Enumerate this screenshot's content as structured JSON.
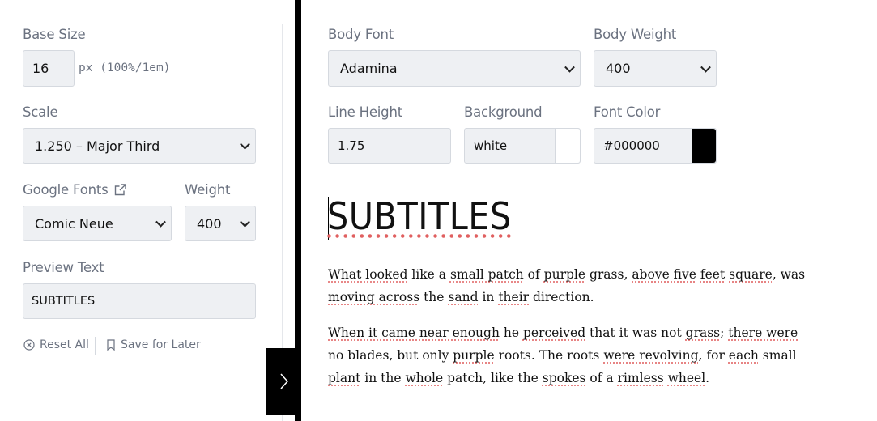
{
  "left_panel": {
    "base_size": {
      "label": "Base Size",
      "value": "16",
      "unit": "px (100%/1em)"
    },
    "scale": {
      "label": "Scale",
      "selected": "1.250 – Major Third"
    },
    "google_fonts": {
      "label": "Google Fonts",
      "selected": "Comic Neue"
    },
    "weight": {
      "label": "Weight",
      "selected": "400"
    },
    "preview_text": {
      "label": "Preview Text",
      "value": "SUBTITLES"
    },
    "actions": {
      "reset": "Reset All",
      "save": "Save for Later"
    }
  },
  "right_panel": {
    "body_font": {
      "label": "Body Font",
      "selected": "Adamina"
    },
    "body_weight": {
      "label": "Body Weight",
      "selected": "400"
    },
    "line_height": {
      "label": "Line Height",
      "value": "1.75"
    },
    "background": {
      "label": "Background",
      "value": "white",
      "swatch": "#ffffff"
    },
    "font_color": {
      "label": "Font Color",
      "value": "#000000",
      "swatch": "#000000"
    },
    "preview": {
      "heading": "SUBTITLES",
      "p1": [
        {
          "t": "What looked",
          "sq": true
        },
        {
          "t": " like a "
        },
        {
          "t": "small patch",
          "sq": true
        },
        {
          "t": " of "
        },
        {
          "t": "purple",
          "sq": true
        },
        {
          "t": " grass, "
        },
        {
          "t": "above five",
          "sq": true
        },
        {
          "t": " "
        },
        {
          "t": "feet",
          "sq": true
        },
        {
          "t": " "
        },
        {
          "t": "square",
          "sq": true
        },
        {
          "t": ", was "
        },
        {
          "t": "moving across",
          "sq": true
        },
        {
          "t": " the "
        },
        {
          "t": "sand",
          "sq": true
        },
        {
          "t": " in "
        },
        {
          "t": "their",
          "sq": true
        },
        {
          "t": " direction."
        }
      ],
      "p2": [
        {
          "t": "When it came near enough",
          "sq": true
        },
        {
          "t": " he "
        },
        {
          "t": "perceived",
          "sq": true
        },
        {
          "t": " that it was not "
        },
        {
          "t": "grass",
          "sq": true
        },
        {
          "t": "; "
        },
        {
          "t": "there were",
          "sq": true
        },
        {
          "t": " no blades, but only "
        },
        {
          "t": "purple",
          "sq": true
        },
        {
          "t": " roots. The roots "
        },
        {
          "t": "were revolving",
          "sq": true
        },
        {
          "t": ", for "
        },
        {
          "t": "each",
          "sq": true
        },
        {
          "t": " small "
        },
        {
          "t": "plant",
          "sq": true
        },
        {
          "t": " in the "
        },
        {
          "t": "whole",
          "sq": true
        },
        {
          "t": " patch, like the "
        },
        {
          "t": "spokes",
          "sq": true
        },
        {
          "t": " of a "
        },
        {
          "t": "rimless",
          "sq": true
        },
        {
          "t": " "
        },
        {
          "t": "wheel",
          "sq": true
        },
        {
          "t": "."
        }
      ]
    }
  },
  "icons": [
    "external-link-icon",
    "reset-icon",
    "bookmark-icon",
    "chevron-right-icon",
    "chevron-down-icon"
  ]
}
